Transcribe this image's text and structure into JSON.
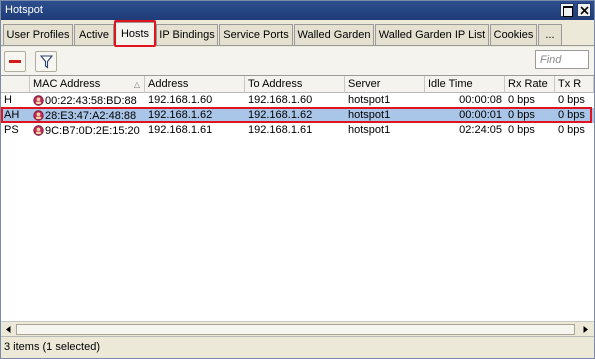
{
  "window": {
    "title": "Hotspot"
  },
  "tabs": [
    {
      "label": "User Profiles",
      "active": false
    },
    {
      "label": "Active",
      "active": false
    },
    {
      "label": "Hosts",
      "active": true
    },
    {
      "label": "IP Bindings",
      "active": false
    },
    {
      "label": "Service Ports",
      "active": false
    },
    {
      "label": "Walled Garden",
      "active": false
    },
    {
      "label": "Walled Garden IP List",
      "active": false
    },
    {
      "label": "Cookies",
      "active": false
    },
    {
      "label": "...",
      "active": false
    }
  ],
  "toolbar": {
    "remove_icon": "minus-icon",
    "filter_icon": "filter-icon",
    "find_placeholder": "Find"
  },
  "table": {
    "columns": [
      "",
      "MAC Address",
      "Address",
      "To Address",
      "Server",
      "Idle Time",
      "Rx Rate",
      "Tx R"
    ],
    "sorted_column": "MAC Address",
    "rows": [
      {
        "flag": "H",
        "mac": "00:22:43:58:BD:88",
        "address": "192.168.1.60",
        "to_address": "192.168.1.60",
        "server": "hotspot1",
        "idle": "00:00:08",
        "rx": "0 bps",
        "tx": "0 bps",
        "selected": false
      },
      {
        "flag": "AH",
        "mac": "28:E3:47:A2:48:88",
        "address": "192.168.1.62",
        "to_address": "192.168.1.62",
        "server": "hotspot1",
        "idle": "00:00:01",
        "rx": "0 bps",
        "tx": "0 bps",
        "selected": true
      },
      {
        "flag": "PS",
        "mac": "9C:B7:0D:2E:15:20",
        "address": "192.168.1.61",
        "to_address": "192.168.1.61",
        "server": "hotspot1",
        "idle": "02:24:05",
        "rx": "0 bps",
        "tx": "0 bps",
        "selected": false
      }
    ]
  },
  "status": {
    "text": "3 items (1 selected)"
  },
  "colors": {
    "highlight": "#e0141e",
    "selection": "#a9c6e8",
    "titlebar": "#2d4e8e"
  }
}
